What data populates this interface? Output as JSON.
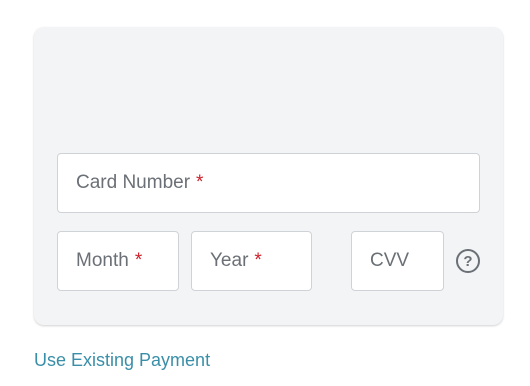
{
  "form": {
    "card_number": {
      "label": "Card Number",
      "required_mark": "*"
    },
    "month": {
      "label": "Month",
      "required_mark": "*"
    },
    "year": {
      "label": "Year",
      "required_mark": "*"
    },
    "cvv": {
      "label": "CVV"
    },
    "help_icon": "question-circle-icon",
    "help_glyph": "?"
  },
  "links": {
    "use_existing_payment": "Use Existing Payment"
  },
  "colors": {
    "panel_background": "#f3f4f6",
    "required": "#d0202a",
    "link": "#3a8fa8",
    "label": "#6b7076"
  }
}
